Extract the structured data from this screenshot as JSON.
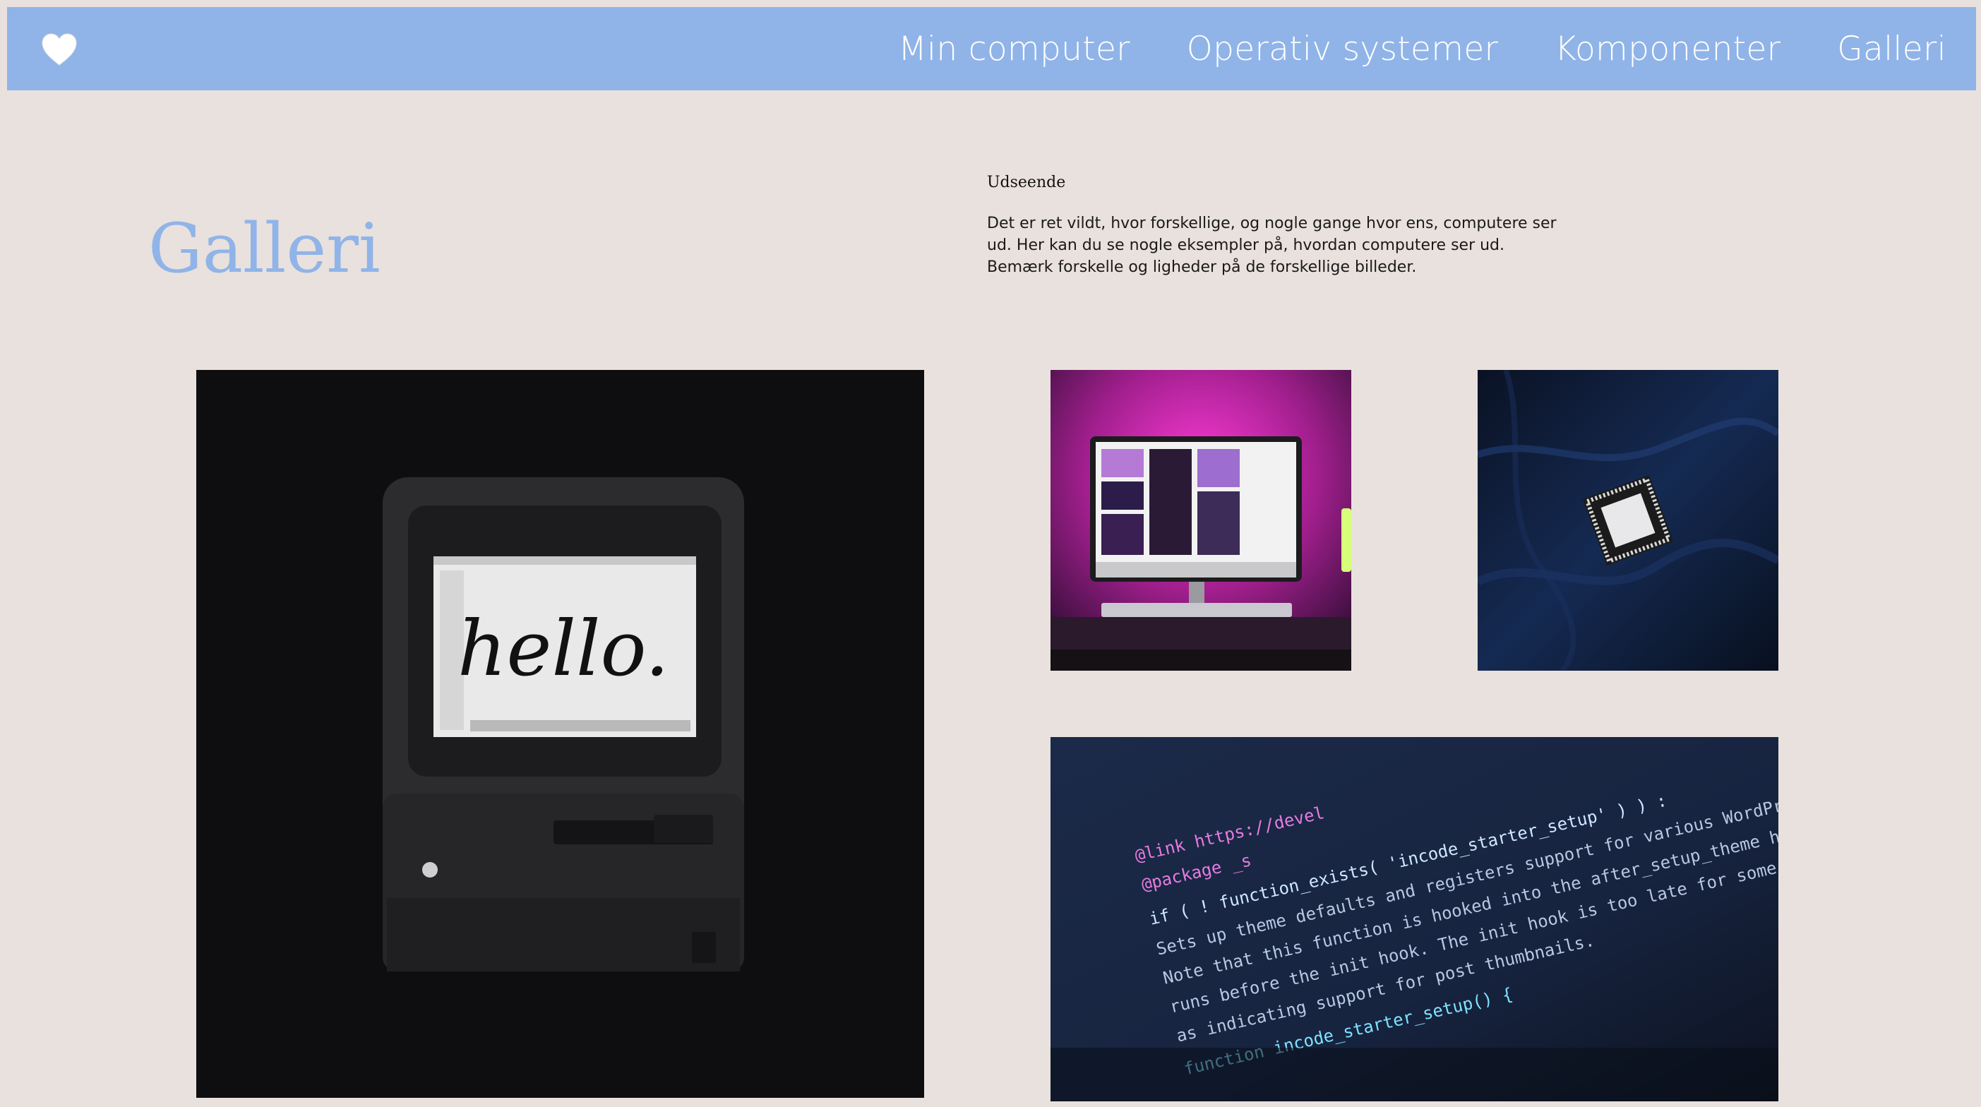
{
  "header": {
    "logo_icon": "heart-icon",
    "nav": [
      {
        "label": "Min computer"
      },
      {
        "label": "Operativ systemer"
      },
      {
        "label": "Komponenter"
      },
      {
        "label": "Galleri"
      }
    ]
  },
  "main": {
    "title": "Galleri",
    "intro": {
      "heading": "Udseende",
      "text": "Det er ret vildt, hvor forskellige, og nogle gange hvor ens, computere ser ud. Her kan du se nogle eksempler på, hvordan computere ser ud. Bemærk forskelle og ligheder på de forskellige billeder."
    },
    "gallery": {
      "mac_screen_text": "hello.",
      "code_lines": [
        "@link https://devel",
        "@package _s",
        "if ( ! function_exists( 'incode_starter_setup' ) ) :",
        "Sets up theme defaults and registers support for various WordPress features.",
        "Note that this function is hooked into the after_setup_theme hook, which",
        "runs before the init hook. The init hook is too late for some features,",
        "as indicating support for post thumbnails.",
        "function incode_starter_setup() {"
      ]
    }
  },
  "colors": {
    "background": "#e9e1dd",
    "accent": "#90b4e8",
    "nav_text": "#ffffff"
  }
}
